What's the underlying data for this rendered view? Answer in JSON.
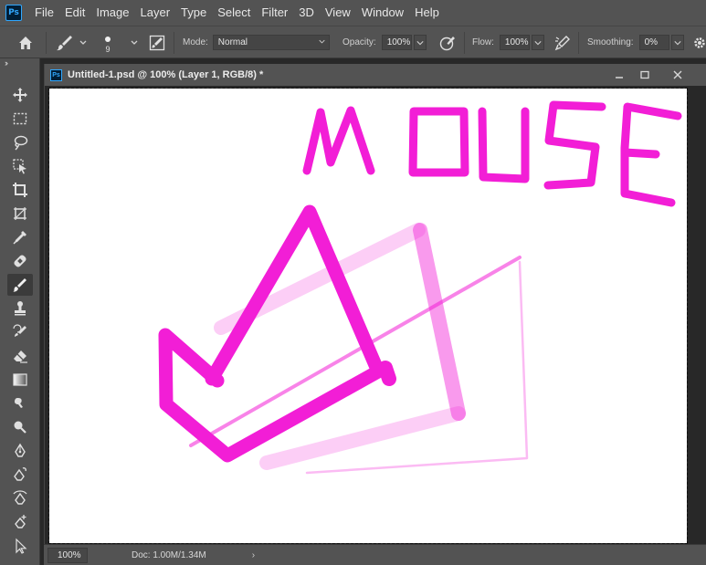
{
  "app": {
    "logo": "Ps"
  },
  "menu": [
    "File",
    "Edit",
    "Image",
    "Layer",
    "Type",
    "Select",
    "Filter",
    "3D",
    "View",
    "Window",
    "Help"
  ],
  "options": {
    "brush_size": "9",
    "mode_label": "Mode:",
    "mode_value": "Normal",
    "opacity_label": "Opacity:",
    "opacity_value": "100%",
    "flow_label": "Flow:",
    "flow_value": "100%",
    "smoothing_label": "Smoothing:",
    "smoothing_value": "0%"
  },
  "document": {
    "icon": "Ps",
    "title": "Untitled-1.psd @ 100% (Layer 1, RGB/8) *"
  },
  "status": {
    "zoom": "100%",
    "doc_info": "Doc: 1.00M/1.34M",
    "arrow": "›"
  },
  "colors": {
    "brush": "#f21ed6",
    "ps_blue": "#31a8ff",
    "ui_bg": "#535353"
  },
  "tools": [
    "move-tool",
    "marquee-tool",
    "lasso-tool",
    "quick-select-tool",
    "crop-tool",
    "frame-tool",
    "eyedropper-tool",
    "healing-brush-tool",
    "brush-tool",
    "clone-stamp-tool",
    "history-brush-tool",
    "eraser-tool",
    "gradient-tool",
    "blur-tool",
    "dodge-tool",
    "pen-tool",
    "freeform-pen-tool",
    "curvature-pen-tool",
    "anchor-point-tool",
    "path-select-tool"
  ]
}
